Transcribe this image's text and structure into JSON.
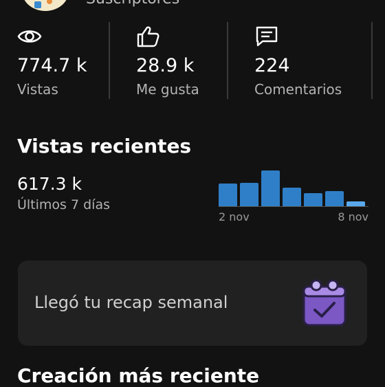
{
  "header": {
    "subscribers_label": "Suscriptores"
  },
  "stats": [
    {
      "icon": "eye-icon",
      "value": "774.7 k",
      "label": "Vistas"
    },
    {
      "icon": "thumbs-up-icon",
      "value": "28.9 k",
      "label": "Me gusta"
    },
    {
      "icon": "comment-icon",
      "value": "224",
      "label": "Comentarios"
    }
  ],
  "recent_views": {
    "title": "Vistas recientes",
    "value": "617.3 k",
    "period": "Últimos 7 días"
  },
  "chart_data": {
    "type": "bar",
    "x_labels": [
      "2 nov",
      "8 nov"
    ],
    "values": [
      32,
      33,
      50,
      26,
      18,
      21,
      7
    ],
    "bar_color": "#2f7fc8",
    "last_bar_color": "#5aa9ec"
  },
  "recap": {
    "text": "Llegó tu recap semanal",
    "icon": "calendar-check-icon"
  },
  "latest": {
    "title": "Creación más reciente"
  },
  "colors": {
    "background": "#121212",
    "card": "#212121",
    "accent": "#2f7fc8",
    "icon_purple": "#7b58c4"
  }
}
